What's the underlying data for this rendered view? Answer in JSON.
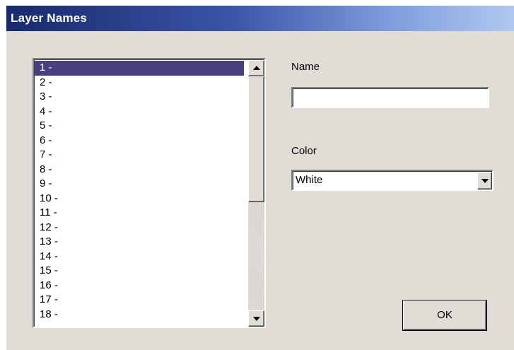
{
  "window": {
    "title": "Layer Names"
  },
  "layer_list": {
    "items": [
      "1 -",
      "2 -",
      "3 -",
      "4 -",
      "5 -",
      "6 -",
      "7 -",
      "8 -",
      "9 -",
      "10 -",
      "11 -",
      "12 -",
      "13 -",
      "14 -",
      "15 -",
      "16 -",
      "17 -",
      "18 -"
    ],
    "selected_index": 0
  },
  "name_field": {
    "label": "Name",
    "value": ""
  },
  "color_field": {
    "label": "Color",
    "value": "White"
  },
  "ok_button": {
    "label": "OK"
  },
  "colors": {
    "selection_bg": "#4a3f7e",
    "dialog_bg": "#e0ddd7",
    "titlebar_start": "#182a6c",
    "titlebar_end": "#b0c8f0"
  },
  "icons": {
    "scroll_up": "triangle-up-icon",
    "scroll_down": "triangle-down-icon",
    "combo_dropdown": "triangle-down-icon"
  }
}
